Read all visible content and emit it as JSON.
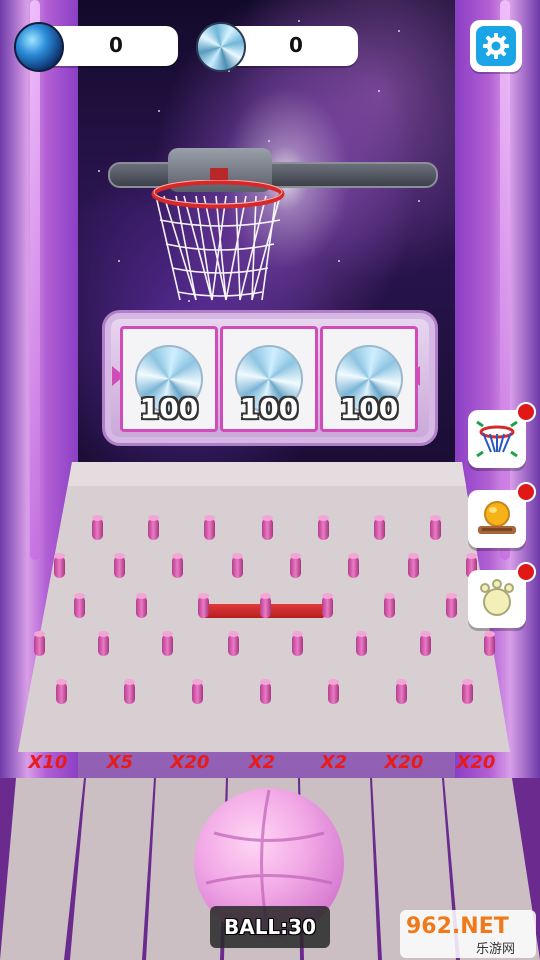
{
  "hud": {
    "gem_blue_count": "0",
    "gem_diamond_count": "0"
  },
  "slots": [
    {
      "value": "100"
    },
    {
      "value": "100"
    },
    {
      "value": "100"
    }
  ],
  "multipliers": [
    "X10",
    "X5",
    "X20",
    "X2",
    "X2",
    "X20",
    "X20"
  ],
  "ball_counter": "BALL:30",
  "watermark": {
    "main": "962.NET",
    "sub": "乐游网"
  },
  "powerups": [
    {
      "icon": "hoop-upgrade-icon"
    },
    {
      "icon": "coin-machine-icon"
    },
    {
      "icon": "pet-paw-icon"
    }
  ],
  "colors": {
    "multiplier_text": "#e81b1b",
    "settings_blue": "#1aa6e6",
    "badge_red": "#e01818",
    "peg_pink": "#e97bc4",
    "ball_pink": "#f2a9e6"
  }
}
